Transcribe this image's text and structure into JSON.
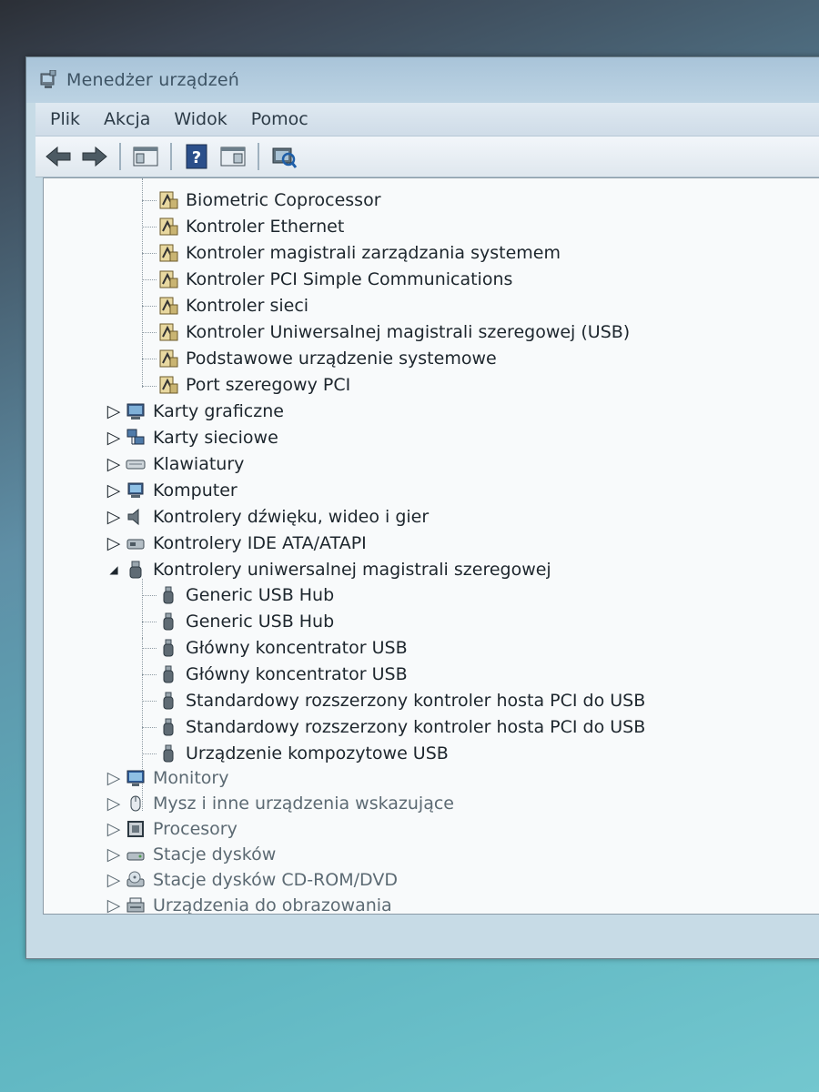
{
  "window": {
    "title": "Menedżer urządzeń",
    "menu": [
      "Plik",
      "Akcja",
      "Widok",
      "Pomoc"
    ]
  },
  "toolbar": {
    "buttons": [
      "back-arrow-icon",
      "forward-arrow-icon",
      "console-tree-icon",
      "help-icon",
      "properties-icon",
      "scan-hardware-icon"
    ]
  },
  "tree": {
    "other_devices_children": [
      "Biometric Coprocessor",
      "Kontroler Ethernet",
      "Kontroler magistrali zarządzania systemem",
      "Kontroler PCI Simple Communications",
      "Kontroler sieci",
      "Kontroler Uniwersalnej magistrali szeregowej (USB)",
      "Podstawowe urządzenie systemowe",
      "Port szeregowy PCI"
    ],
    "categories_a": [
      {
        "label": "Karty graficzne",
        "icon": "display-adapter-icon"
      },
      {
        "label": "Karty sieciowe",
        "icon": "network-adapter-icon"
      },
      {
        "label": "Klawiatury",
        "icon": "keyboard-icon"
      },
      {
        "label": "Komputer",
        "icon": "computer-icon"
      },
      {
        "label": "Kontrolery dźwięku, wideo i gier",
        "icon": "speaker-icon"
      },
      {
        "label": "Kontrolery IDE ATA/ATAPI",
        "icon": "ide-controller-icon"
      }
    ],
    "usb_category": "Kontrolery uniwersalnej magistrali szeregowej",
    "usb_children": [
      "Generic USB Hub",
      "Generic USB Hub",
      "Główny koncentrator USB",
      "Główny koncentrator USB",
      "Standardowy rozszerzony kontroler hosta PCI do USB",
      "Standardowy rozszerzony kontroler hosta PCI do USB",
      "Urządzenie kompozytowe USB"
    ],
    "categories_b": [
      {
        "label": "Monitory",
        "icon": "monitor-icon"
      },
      {
        "label": "Mysz i inne urządzenia wskazujące",
        "icon": "mouse-icon"
      },
      {
        "label": "Procesory",
        "icon": "processor-icon"
      },
      {
        "label": "Stacje dysków",
        "icon": "disk-drive-icon"
      },
      {
        "label": "Stacje dysków CD-ROM/DVD",
        "icon": "cdrom-icon"
      },
      {
        "label": "Urządzenia do obrazowania",
        "icon": "imaging-device-icon"
      }
    ]
  }
}
